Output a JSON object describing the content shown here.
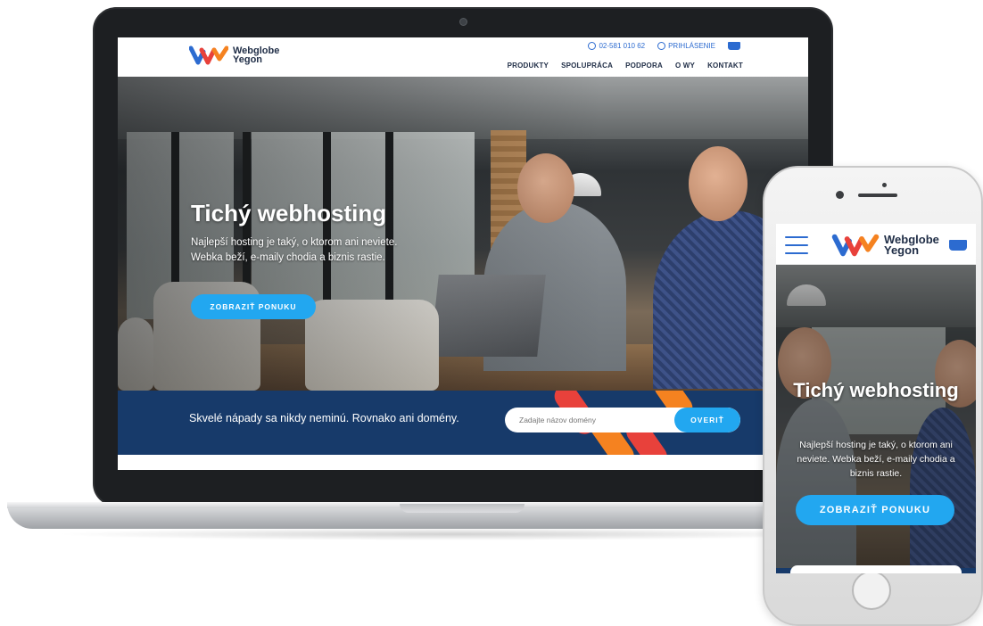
{
  "desktop": {
    "brand": {
      "line1": "Webglobe",
      "line2": "Yegon"
    },
    "utility": {
      "phone": "02-581 010 62",
      "login": "PRIHLÁSENIE"
    },
    "nav": [
      "PRODUKTY",
      "SPOLUPRÁCA",
      "PODPORA",
      "O WY",
      "KONTAKT"
    ],
    "hero": {
      "title": "Tichý webhosting",
      "text": "Najlepší hosting je taký, o ktorom ani neviete. Webka beží, e-maily chodia a biznis rastie.",
      "button": "ZOBRAZIŤ PONUKU"
    },
    "domain_band": {
      "text": "Skvelé nápady sa nikdy neminú. Rovnako ani domény.",
      "placeholder": "Zadajte názov domény",
      "button": "OVERIŤ"
    }
  },
  "mobile": {
    "brand": {
      "line1": "Webglobe",
      "line2": "Yegon"
    },
    "hero": {
      "title": "Tichý webhosting",
      "text": "Najlepší hosting je taký, o ktorom ani neviete. Webka beží, e-maily chodia a biznis rastie.",
      "button": "ZOBRAZIŤ PONUKU"
    }
  },
  "colors": {
    "navy": "#173a6a",
    "accent": "#22a7f0",
    "brand_blue": "#2c6bd0",
    "brand_red": "#e8413b",
    "brand_orange": "#f58220"
  },
  "icons": [
    "phone-icon",
    "user-icon",
    "cart-icon",
    "hamburger-menu-icon",
    "webglobe-logo-icon"
  ]
}
